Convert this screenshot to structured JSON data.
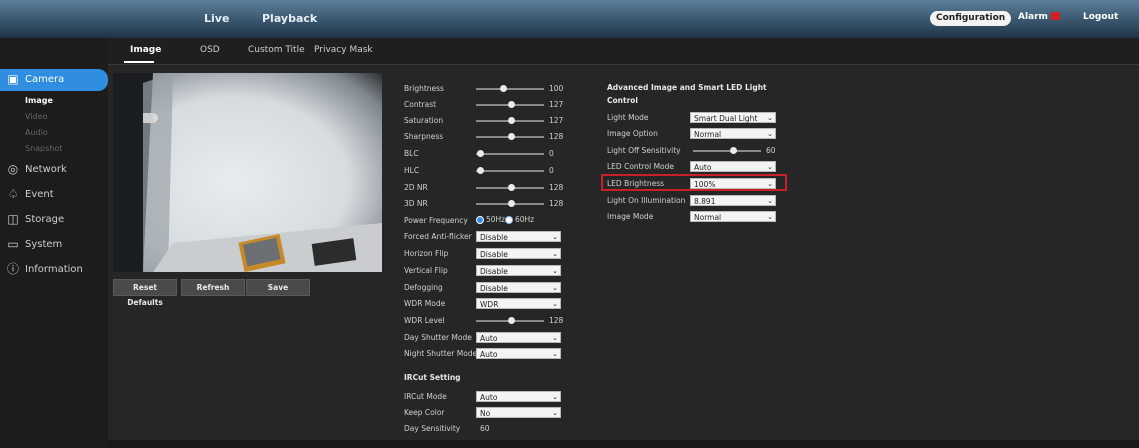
{
  "topnav": {
    "live": "Live",
    "playback": "Playback",
    "configuration": "Configuration",
    "alarm": "Alarm",
    "logout": "Logout"
  },
  "sidebar": {
    "items": [
      {
        "label": "Camera",
        "icon": "camera-icon"
      },
      {
        "label": "Network",
        "icon": "network-globe-icon"
      },
      {
        "label": "Event",
        "icon": "event-icon"
      },
      {
        "label": "Storage",
        "icon": "storage-icon"
      },
      {
        "label": "System",
        "icon": "monitor-icon"
      },
      {
        "label": "Information",
        "icon": "info-icon"
      }
    ],
    "camera_sub": [
      "Image",
      "Video",
      "Audio",
      "Snapshot"
    ]
  },
  "tabs": [
    "Image",
    "OSD",
    "Custom Title",
    "Privacy Mask"
  ],
  "preview_buttons": {
    "reset": "Reset Defaults",
    "refresh": "Refresh",
    "save": "Save"
  },
  "image": {
    "brightness": {
      "label": "Brightness",
      "value": "100"
    },
    "contrast": {
      "label": "Contrast",
      "value": "127"
    },
    "saturation": {
      "label": "Saturation",
      "value": "127"
    },
    "sharpness": {
      "label": "Sharpness",
      "value": "128"
    },
    "blc": {
      "label": "BLC",
      "value": "0"
    },
    "hlc": {
      "label": "HLC",
      "value": "0"
    },
    "nr2d": {
      "label": "2D NR",
      "value": "128"
    },
    "nr3d": {
      "label": "3D NR",
      "value": "128"
    },
    "power_frequency": {
      "label": "Power Frequency",
      "opt1": "50Hz",
      "opt2": "60Hz"
    },
    "forced_antiflicker": {
      "label": "Forced Anti-flicker",
      "value": "Disable"
    },
    "horizon_flip": {
      "label": "Horizon Flip",
      "value": "Disable"
    },
    "vertical_flip": {
      "label": "Vertical Flip",
      "value": "Disable"
    },
    "defogging": {
      "label": "Defogging",
      "value": "Disable"
    },
    "wdr_mode": {
      "label": "WDR Mode",
      "value": "WDR"
    },
    "wdr_level": {
      "label": "WDR Level",
      "value": "128"
    },
    "day_shutter": {
      "label": "Day Shutter Mode",
      "value": "Auto"
    },
    "night_shutter": {
      "label": "Night Shutter Mode",
      "value": "Auto"
    }
  },
  "ircut": {
    "title": "IRCut Setting",
    "mode": {
      "label": "IRCut Mode",
      "value": "Auto"
    },
    "keep_color": {
      "label": "Keep Color",
      "value": "No"
    },
    "day_sensitivity": {
      "label": "Day Sensitivity",
      "value": "60"
    }
  },
  "advanced": {
    "title1": "Advanced Image and Smart LED Light",
    "title2": "Control",
    "light_mode": {
      "label": "Light Mode",
      "value": "Smart Dual Light"
    },
    "image_option": {
      "label": "Image Option",
      "value": "Normal"
    },
    "light_off_sensitivity": {
      "label": "Light Off Sensitivity",
      "value": "60"
    },
    "led_control_mode": {
      "label": "LED Control Mode",
      "value": "Auto"
    },
    "led_brightness": {
      "label": "LED Brightness",
      "value": "100%"
    },
    "light_on_illumination": {
      "label": "Light On Illumination",
      "value": "8.891"
    },
    "image_mode": {
      "label": "Image Mode",
      "value": "Normal"
    }
  },
  "colors": {
    "accent": "#2f8ee0",
    "highlight": "#c8202a"
  }
}
